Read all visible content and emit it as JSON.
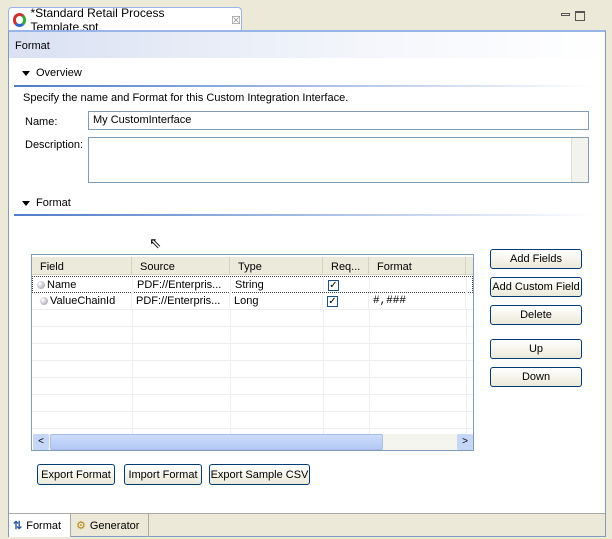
{
  "editor_tab": {
    "title": "*Standard Retail Process Template.spt",
    "close_icon": "close-icon",
    "app_icon": "process-icon"
  },
  "page_header": "Format",
  "overview": {
    "title": "Overview",
    "description": "Specify the name and Format for this Custom Integration Interface.",
    "name_label": "Name:",
    "name_value": "My CustomInterface",
    "description_label": "Description:",
    "description_value": ""
  },
  "format_section": {
    "title": "Format"
  },
  "table": {
    "columns": [
      "Field",
      "Source",
      "Type",
      "Req...",
      "Format"
    ],
    "rows": [
      {
        "field": "Name",
        "source": "PDF://Enterpris...",
        "type": "String",
        "required": true,
        "format": ""
      },
      {
        "field": "ValueChainId",
        "source": "PDF://Enterpris...",
        "type": "Long",
        "required": true,
        "format": "#,###"
      }
    ]
  },
  "buttons": {
    "add_fields": "Add Fields",
    "add_custom_field": "Add Custom Field",
    "delete": "Delete",
    "up": "Up",
    "down": "Down",
    "export_format": "Export Format",
    "import_format": "Import Format",
    "export_sample_csv": "Export Sample CSV"
  },
  "bottom_tabs": [
    {
      "label": "Format",
      "active": true
    },
    {
      "label": "Generator",
      "active": false
    }
  ]
}
